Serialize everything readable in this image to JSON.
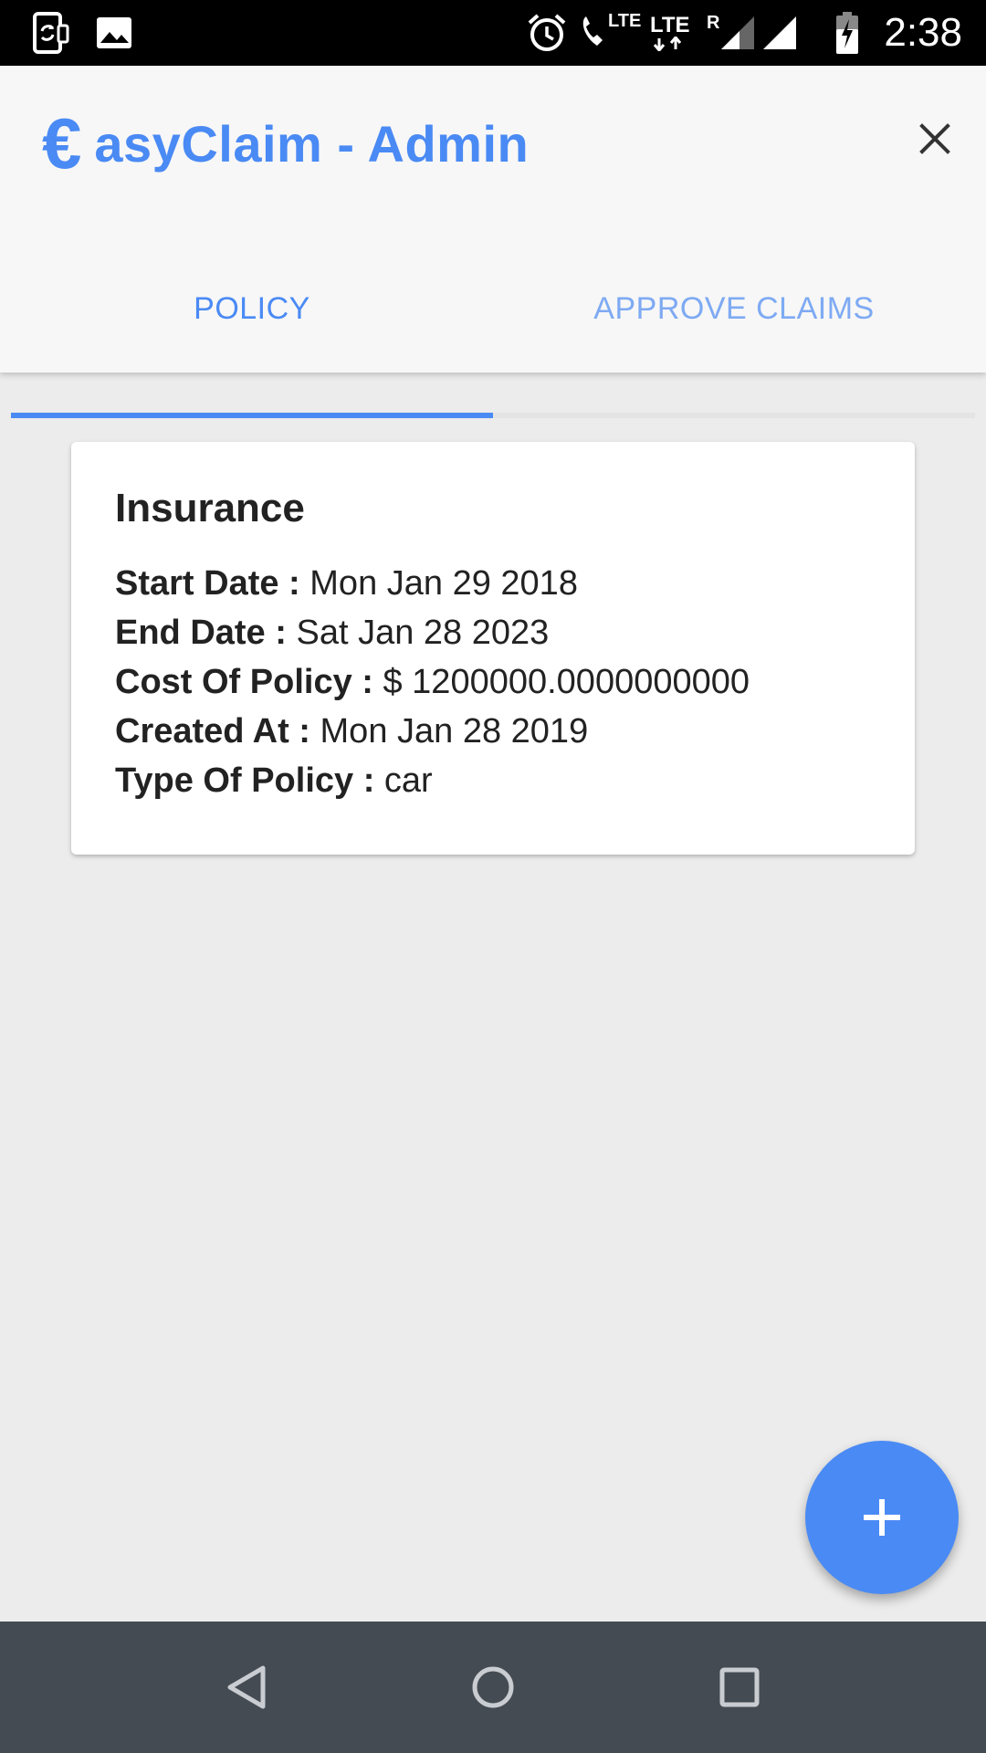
{
  "status_bar": {
    "time": "2:38",
    "lte_call_label": "LTE",
    "lte_data_label": "LTE",
    "roaming_label": "R",
    "icons": [
      "screen-rotation-icon",
      "image-icon",
      "alarm-icon",
      "phone-lte-icon",
      "lte-data-icon",
      "signal-roaming-icon",
      "signal-icon",
      "battery-charging-icon"
    ]
  },
  "header": {
    "brand_symbol": "€",
    "brand_text": "asyClaim - Admin",
    "close_icon": "close-icon",
    "accent_color": "#4a8af4"
  },
  "tabs": [
    {
      "label": "POLICY",
      "active": true
    },
    {
      "label": "APPROVE CLAIMS",
      "active": false
    }
  ],
  "policy_card": {
    "title": "Insurance",
    "fields": [
      {
        "label": "Start Date :",
        "value": "Mon Jan 29 2018"
      },
      {
        "label": "End Date :",
        "value": "Sat Jan 28 2023"
      },
      {
        "label": "Cost Of Policy :",
        "value": "$ 1200000.0000000000"
      },
      {
        "label": "Created At :",
        "value": "Mon Jan 28 2019"
      },
      {
        "label": "Type Of Policy :",
        "value": "car"
      }
    ]
  },
  "fab": {
    "icon": "plus-icon"
  },
  "nav_bar": {
    "icons": [
      "back-icon",
      "home-icon",
      "recents-icon"
    ]
  }
}
